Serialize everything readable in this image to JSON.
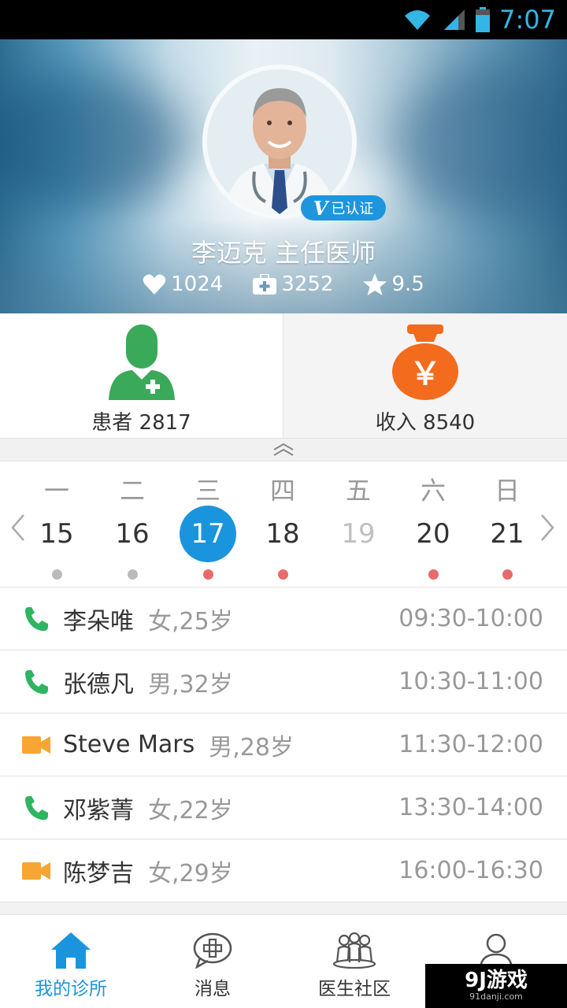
{
  "status_bar": {
    "time": "7:07"
  },
  "profile": {
    "name_title": "李迈克 主任医师",
    "verified_v": "V",
    "verified_label": "已认证",
    "stats": {
      "likes": "1024",
      "consultations": "3252",
      "rating": "9.5"
    }
  },
  "tiles": {
    "patients_label": "患者 2817",
    "income_label": "收入 8540",
    "income_symbol": "￥"
  },
  "calendar": {
    "days": [
      {
        "weekday": "一",
        "date": "15",
        "dot": "grey",
        "state": "normal"
      },
      {
        "weekday": "二",
        "date": "16",
        "dot": "grey",
        "state": "normal"
      },
      {
        "weekday": "三",
        "date": "17",
        "dot": "red",
        "state": "selected"
      },
      {
        "weekday": "四",
        "date": "18",
        "dot": "red",
        "state": "normal"
      },
      {
        "weekday": "五",
        "date": "19",
        "dot": "none",
        "state": "disabled"
      },
      {
        "weekday": "六",
        "date": "20",
        "dot": "red",
        "state": "normal"
      },
      {
        "weekday": "日",
        "date": "21",
        "dot": "red",
        "state": "normal"
      }
    ]
  },
  "appointments": [
    {
      "type": "phone",
      "name": "李朵唯",
      "info": "女,25岁",
      "time": "09:30-10:00"
    },
    {
      "type": "phone",
      "name": "张德凡",
      "info": "男,32岁",
      "time": "10:30-11:00"
    },
    {
      "type": "video",
      "name": "Steve Mars",
      "info": "男,28岁",
      "time": "11:30-12:00"
    },
    {
      "type": "phone",
      "name": "邓紫菁",
      "info": "女,22岁",
      "time": "13:30-14:00"
    },
    {
      "type": "video",
      "name": "陈梦吉",
      "info": "女,29岁",
      "time": "16:00-16:30"
    }
  ],
  "bottom_nav": {
    "my_clinic": "我的诊所",
    "messages": "消息",
    "community": "医生社区"
  },
  "watermark": {
    "main": "9J游戏",
    "sub": "91danji.com"
  },
  "colors": {
    "accent": "#1a95dd",
    "phone_icon": "#2db561",
    "video_icon": "#f7a533",
    "patients_icon": "#3aa95a",
    "income_icon": "#f36b1c",
    "dot_active": "#e86a6a",
    "dot_inactive": "#bbbbbb"
  }
}
